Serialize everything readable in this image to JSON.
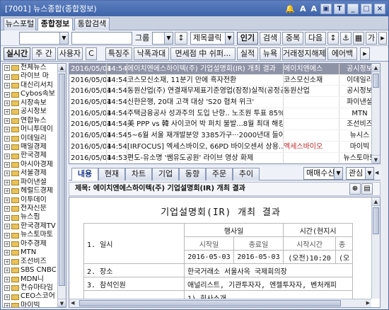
{
  "window": {
    "title": "[7001] 뉴스종합(종합정보)",
    "buttons": [
      "▣",
      "T",
      "_",
      "□",
      "×"
    ],
    "title_extra": [
      "🔔",
      "A",
      "A"
    ]
  },
  "tabs": [
    "뉴스포털",
    "종합정보",
    "통합검색"
  ],
  "toolbar1": {
    "category_value": "",
    "search_value": "",
    "group_label": "그룹",
    "group_value": "",
    "title_click_label": "제목클릭",
    "popular_btn": "인기",
    "search_btn": "검색",
    "dup_btn": "중복",
    "next_btn": "다음",
    "toggle_btn": "↕",
    "misc": [
      "⚓",
      "▦",
      "가",
      "▸"
    ]
  },
  "toolbar2": {
    "buttons": [
      "실시간",
      "주 간",
      "사용자",
      "C",
      "특징주",
      "낙폭과대",
      "면세점 中 쉬퍼...",
      "실적",
      "뉴욕",
      "거래정지해제",
      "에어백",
      "▸"
    ]
  },
  "sidebar": {
    "items": [
      "전체뉴스",
      "라이브 마",
      "대신리서치",
      "Cybos속보",
      "시장속보",
      "공시정보",
      "연합뉴스",
      "머니투데이",
      "이데일리",
      "매일경제",
      "한국경제",
      "아시아경제",
      "서울경제",
      "파이낸셜",
      "헤럴드경제",
      "이투데이",
      "전자신문",
      "뉴스핌",
      "한국경제TV",
      "뉴스토마토",
      "아주경제",
      "MTN",
      "조선비즈",
      "SBS CNBC",
      "MDN니",
      "컨슈마타임",
      "CEO스코어",
      "마이빅",
      "해외뉴스"
    ]
  },
  "news": {
    "rows": [
      {
        "date": "2016/05/04",
        "time": "14:54",
        "title": "에이치엔에스하이텍(주) 기업설명회(IR) 개최 결과",
        "corp": "에이치엔에스",
        "source": "공시정보",
        "selected": true,
        "corp_red": false
      },
      {
        "date": "2016/05/04",
        "time": "14:54",
        "title": "코스모신소재, 11분기 만에 흑자전환",
        "corp": "코스모신소재",
        "source": "이데일리",
        "selected": false,
        "corp_red": false
      },
      {
        "date": "2016/05/04",
        "time": "14:54",
        "title": "동원산업(주) 연결재무제표기준영업(잠정)실적(공정공시)",
        "corp": "동원산업",
        "source": "공시정보",
        "selected": false,
        "corp_red": false
      },
      {
        "date": "2016/05/04",
        "time": "14:54",
        "title": "신한은행, 20대 고객 대상 'S20 협쳐 위크'",
        "corp": "",
        "source": "파이낸셜",
        "selected": false,
        "corp_red": false
      },
      {
        "date": "2016/05/04",
        "time": "14:54",
        "title": "주택금융공사 성과주의 도입 난항.. 노조원 투표 85%'반대",
        "corp": "",
        "source": "MTN",
        "selected": false,
        "corp_red": false
      },
      {
        "date": "2016/05/04",
        "time": "14:54",
        "title": "美 PPP vs 韓 사이코어 박 퍼치 불발...8월 최대 해킹 방",
        "corp": "",
        "source": "조선비즈",
        "selected": false,
        "corp_red": false
      },
      {
        "date": "2016/05/04",
        "time": "14:54",
        "title": "5~6월 서울 재개발분양 3385가구···2000년대 들어 최다",
        "corp": "",
        "source": "뉴시스",
        "selected": false,
        "corp_red": false
      },
      {
        "date": "2016/05/04",
        "time": "14:54",
        "title": "[IRFOCUS] 엑세스바이오, 66PD 바이오센서 상용...",
        "corp": "엑세스바이오",
        "source": "마이빅",
        "selected": false,
        "corp_red": true
      },
      {
        "date": "2016/05/04",
        "time": "14:53",
        "title": "편도-유소명 '쌤유도공원' 라이브 영상 화제",
        "corp": "",
        "source": "뉴스토마토",
        "selected": false,
        "corp_red": false
      }
    ]
  },
  "content_tabs": [
    "내용",
    "현재",
    "차트",
    "기업",
    "동향",
    "주문",
    "추이"
  ],
  "content_tools": {
    "trade_label": "매매수신",
    "interest_label": "관심"
  },
  "subject": {
    "label": "제목:",
    "text": "에이치엔에스하이텍(주) 기업설명회(IR) 개최 결과"
  },
  "document": {
    "title": "기업설명회(IR) 개최 결과",
    "rows": {
      "r1_label": "1. 일시",
      "date_header": "행사일",
      "time_header": "시간(현지시",
      "start_date_h": "시작일",
      "end_date_h": "종료일",
      "start_time_h": "시작시간",
      "end_time_h": "종",
      "start_date": "2016-05-03",
      "end_date": "2016-05-03",
      "start_time": "(오전)10:20",
      "end_time": "(오",
      "r2_label": "2. 장소",
      "r2_value": "한국거래소 서울사옥 국제회의장",
      "r3_label": "3. 참석인원",
      "r3_value": "애널리스트, 기관투자자, 엔젤투자자, 벤처캐피",
      "r4_value": "1) 회사소개"
    }
  }
}
